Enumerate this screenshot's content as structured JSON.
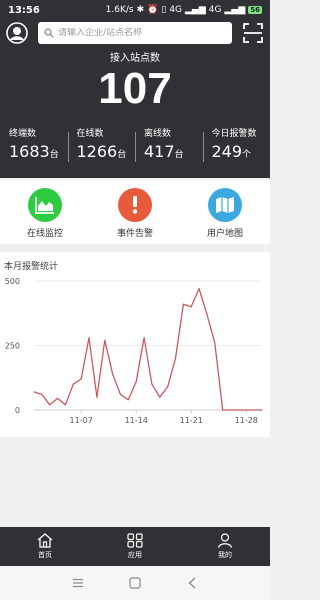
{
  "status_bar": {
    "time": "13:56",
    "speed": "1.6K/s",
    "signal1": "4G",
    "signal2": "4G",
    "battery": "56"
  },
  "header": {
    "search_placeholder": "请输入企业/站点名称",
    "subtitle": "接入站点数",
    "big_number": "107"
  },
  "stats": [
    {
      "label": "终端数",
      "value": "1683",
      "unit": "台"
    },
    {
      "label": "在线数",
      "value": "1266",
      "unit": "台"
    },
    {
      "label": "离线数",
      "value": "417",
      "unit": "台"
    },
    {
      "label": "今日报警数",
      "value": "249",
      "unit": "个"
    }
  ],
  "actions": [
    {
      "label": "在线监控",
      "icon": "chart-area-icon",
      "color": "#2ecc40"
    },
    {
      "label": "事件告警",
      "icon": "exclamation-icon",
      "color": "#e85a3c"
    },
    {
      "label": "用户地图",
      "icon": "map-icon",
      "color": "#3ba9e0"
    }
  ],
  "chart": {
    "title": "本月报警统计"
  },
  "chart_data": {
    "type": "line",
    "x": [
      "11-01",
      "11-02",
      "11-03",
      "11-04",
      "11-05",
      "11-06",
      "11-07",
      "11-08",
      "11-09",
      "11-10",
      "11-11",
      "11-12",
      "11-13",
      "11-14",
      "11-15",
      "11-16",
      "11-17",
      "11-18",
      "11-19",
      "11-20",
      "11-21",
      "11-22",
      "11-23",
      "11-24",
      "11-25",
      "11-26",
      "11-27",
      "11-28",
      "11-29",
      "11-30"
    ],
    "values": [
      70,
      60,
      20,
      45,
      20,
      100,
      120,
      280,
      50,
      270,
      140,
      60,
      40,
      110,
      280,
      100,
      50,
      90,
      200,
      410,
      400,
      470,
      370,
      260,
      0,
      0,
      0,
      0,
      0,
      0
    ],
    "xticks": [
      "11-07",
      "11-14",
      "11-21",
      "11-28"
    ],
    "yticks": [
      "0",
      "250",
      "500"
    ],
    "ylim": [
      0,
      500
    ],
    "line_color": "#c9595b",
    "grid": true
  },
  "bottom_nav": [
    {
      "label": "首页",
      "icon": "home-icon"
    },
    {
      "label": "应用",
      "icon": "apps-icon"
    },
    {
      "label": "我的",
      "icon": "user-icon"
    }
  ]
}
